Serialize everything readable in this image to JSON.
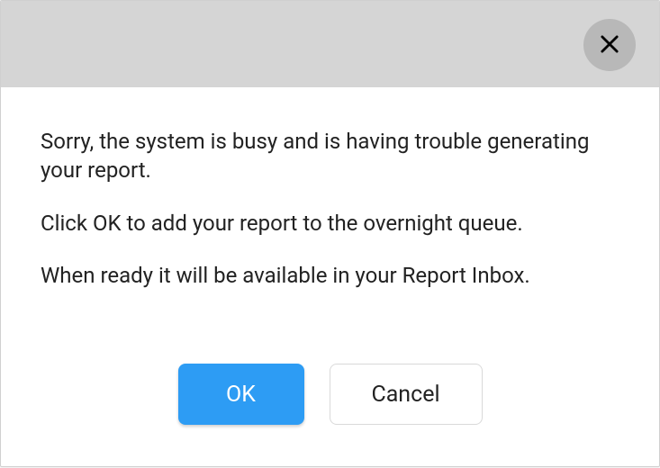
{
  "dialog": {
    "messages": {
      "line1": "Sorry, the system is busy and is having trouble generating your report.",
      "line2": "Click OK to add your report to the overnight queue.",
      "line3": "When ready it will be available in your Report Inbox."
    },
    "buttons": {
      "ok_label": "OK",
      "cancel_label": "Cancel"
    }
  }
}
